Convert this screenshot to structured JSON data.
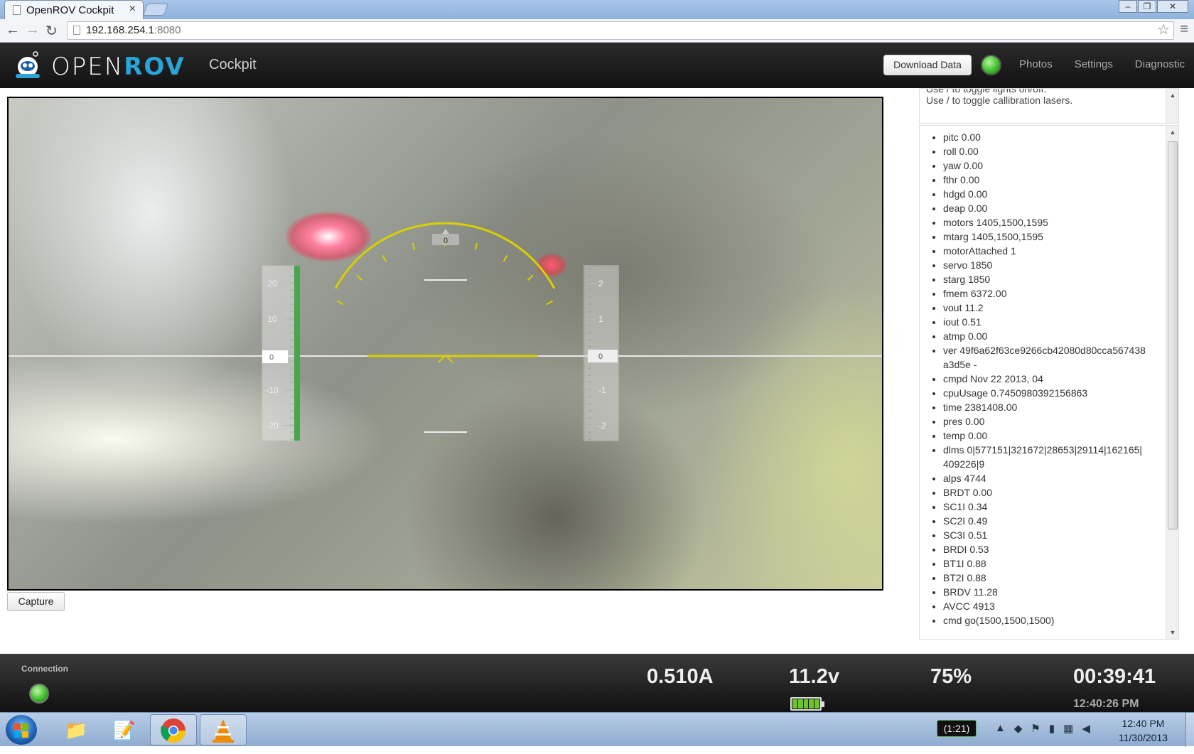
{
  "browser": {
    "tab_title": "OpenROV Cockpit",
    "tab_close": "×",
    "url_host": "192.168.254.1",
    "url_port": ":8080"
  },
  "header": {
    "brand_open": "OPEN",
    "brand_rov": "ROV",
    "subtitle": "Cockpit",
    "download_label": "Download Data",
    "links": [
      "Photos",
      "Settings",
      "Diagnostic"
    ]
  },
  "help": {
    "line1": "Use / to toggle lights on/off.",
    "line2": "Use / to toggle callibration lasers."
  },
  "hud": {
    "heading_value": "0",
    "depth_value": "0",
    "pitch_value": "0",
    "left_scale": [
      "20",
      "10",
      "-10",
      "-20"
    ],
    "right_scale": [
      "2",
      "1",
      "-1",
      "-2"
    ]
  },
  "capture_label": "Capture",
  "telemetry": [
    "pitc 0.00",
    "roll 0.00",
    "yaw 0.00",
    "fthr 0.00",
    "hdgd 0.00",
    "deap 0.00",
    "motors 1405,1500,1595",
    "mtarg 1405,1500,1595",
    "motorAttached 1",
    "servo 1850",
    "starg 1850",
    "fmem 6372.00",
    "vout 11.2",
    "iout 0.51",
    "atmp 0.00",
    "ver 49f6a62f63ce9266cb42080d80cca567438a3d5e -",
    "cmpd Nov 22 2013, 04",
    "cpuUsage 0.7450980392156863",
    "time 2381408.00",
    "pres 0.00",
    "temp 0.00",
    "dlms 0|577151|321672|28653|29114|162165|409226|9",
    "alps 4744",
    "BRDT 0.00",
    "SC1I 0.34",
    "SC2I 0.49",
    "SC3I 0.51",
    "BRDI 0.53",
    "BT1I 0.88",
    "BT2I 0.88",
    "BRDV 11.28",
    "AVCC 4913",
    "cmd go(1500,1500,1500)"
  ],
  "footer": {
    "connection_label": "Connection",
    "current": "0.510A",
    "voltage": "11.2v",
    "throttle": "75%",
    "elapsed": "00:39:41",
    "time": "12:40:26 PM",
    "battery_level": 1.0
  },
  "taskbar": {
    "battery": "(1:21)",
    "time": "12:40 PM",
    "date": "11/30/2013"
  },
  "colors": {
    "accent": "#2aa3d8",
    "hud_yellow": "#d8d000",
    "led_green": "#3fbf2a"
  }
}
